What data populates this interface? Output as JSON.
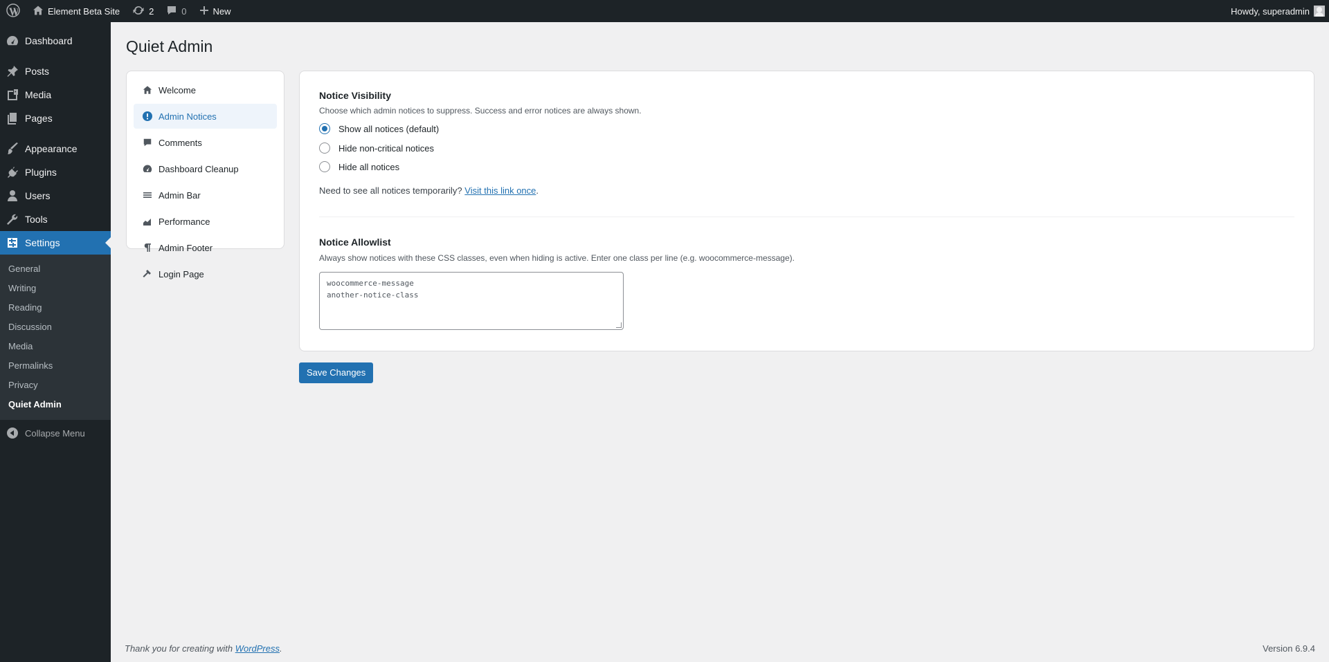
{
  "admin_bar": {
    "site_name": "Element Beta Site",
    "updates_count": "2",
    "comments_count": "0",
    "new_label": "New",
    "howdy": "Howdy, superadmin"
  },
  "menu": {
    "dashboard": "Dashboard",
    "posts": "Posts",
    "media": "Media",
    "pages": "Pages",
    "appearance": "Appearance",
    "plugins": "Plugins",
    "users": "Users",
    "tools": "Tools",
    "settings": "Settings",
    "submenu": [
      "General",
      "Writing",
      "Reading",
      "Discussion",
      "Media",
      "Permalinks",
      "Privacy",
      "Quiet Admin"
    ],
    "collapse": "Collapse Menu"
  },
  "page": {
    "title": "Quiet Admin"
  },
  "plugin_nav": {
    "items": [
      "Welcome",
      "Admin Notices",
      "Comments",
      "Dashboard Cleanup",
      "Admin Bar",
      "Performance",
      "Admin Footer",
      "Login Page"
    ],
    "active": "Admin Notices"
  },
  "notice_visibility": {
    "title": "Notice Visibility",
    "description": "Choose which admin notices to suppress. Success and error notices are always shown.",
    "options": [
      "Show all notices (default)",
      "Hide non-critical notices",
      "Hide all notices"
    ],
    "selected": "Show all notices (default)",
    "hint_text": "Need to see all notices temporarily?",
    "hint_link": "Visit this link once",
    "hint_end": "."
  },
  "notice_allowlist": {
    "title": "Notice Allowlist",
    "description": "Always show notices with these CSS classes, even when hiding is active. Enter one class per line (e.g. woocommerce-message).",
    "lines": [
      "woocommerce-message",
      "another-notice-class"
    ]
  },
  "save_button": "Save Changes",
  "footer": {
    "thanks": "Thank you for creating with",
    "link": "WordPress",
    "end": ".",
    "version": "Version 6.9.4"
  },
  "colors": {
    "accent": "#2271b1",
    "admin_bar": "#1d2327",
    "submenu_bg": "#2c3338",
    "page_bg": "#f0f0f1"
  }
}
